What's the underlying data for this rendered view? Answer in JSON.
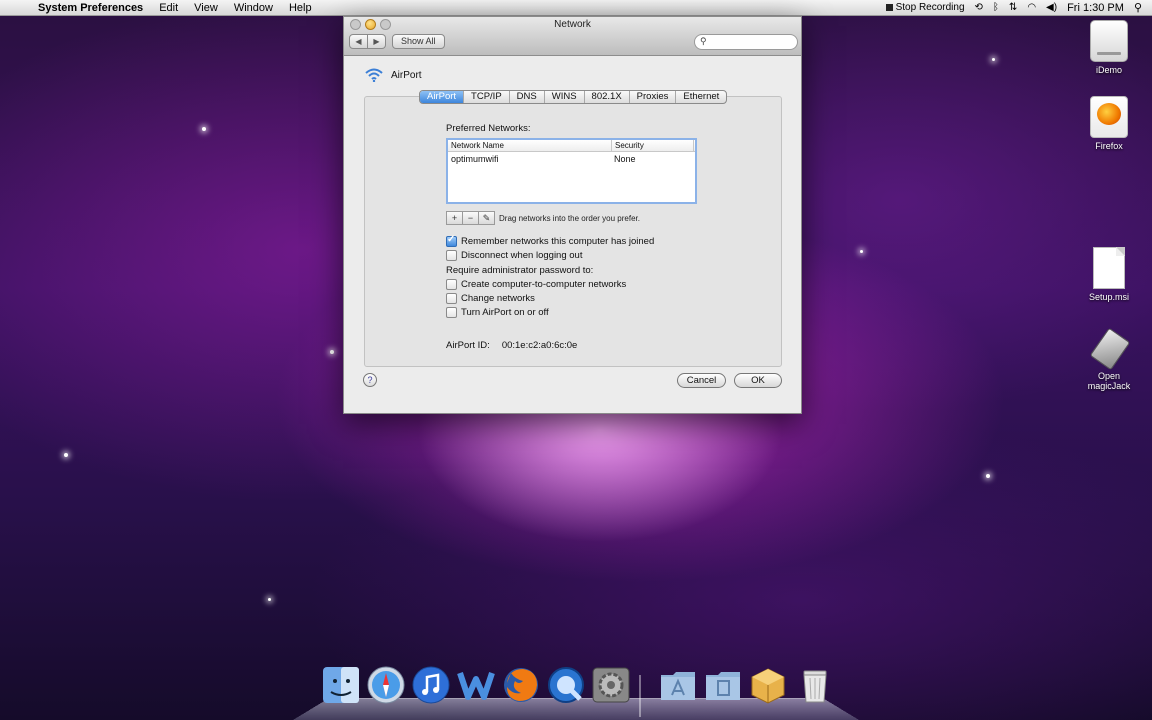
{
  "menubar": {
    "app_name": "System Preferences",
    "items": [
      "Edit",
      "View",
      "Window",
      "Help"
    ],
    "stop_recording": "Stop Recording",
    "clock": "Fri 1:30 PM"
  },
  "window": {
    "title": "Network",
    "show_all": "Show All",
    "search_placeholder": ""
  },
  "airport": {
    "header": "AirPort",
    "tabs": [
      "AirPort",
      "TCP/IP",
      "DNS",
      "WINS",
      "802.1X",
      "Proxies",
      "Ethernet"
    ],
    "active_tab": "AirPort",
    "preferred_label": "Preferred Networks:",
    "table": {
      "columns": [
        "Network Name",
        "Security"
      ],
      "rows": [
        {
          "name": "optimumwifi",
          "security": "None"
        }
      ]
    },
    "list_buttons": [
      "+",
      "−",
      "✎"
    ],
    "drag_hint": "Drag networks into the order you prefer.",
    "options": {
      "remember": {
        "label": "Remember networks this computer has joined",
        "checked": true
      },
      "disconnect": {
        "label": "Disconnect when logging out",
        "checked": false
      },
      "require_label": "Require administrator password to:",
      "create": {
        "label": "Create computer-to-computer networks",
        "checked": false
      },
      "change": {
        "label": "Change networks",
        "checked": false
      },
      "toggle": {
        "label": "Turn AirPort on or off",
        "checked": false
      }
    },
    "airport_id_label": "AirPort ID:",
    "airport_id_value": "00:1e:c2:a0:6c:0e",
    "help": "?",
    "cancel": "Cancel",
    "ok": "OK"
  },
  "desktop_icons": [
    "iDemo",
    "Firefox",
    "Setup.msi",
    "Open magicJack"
  ]
}
